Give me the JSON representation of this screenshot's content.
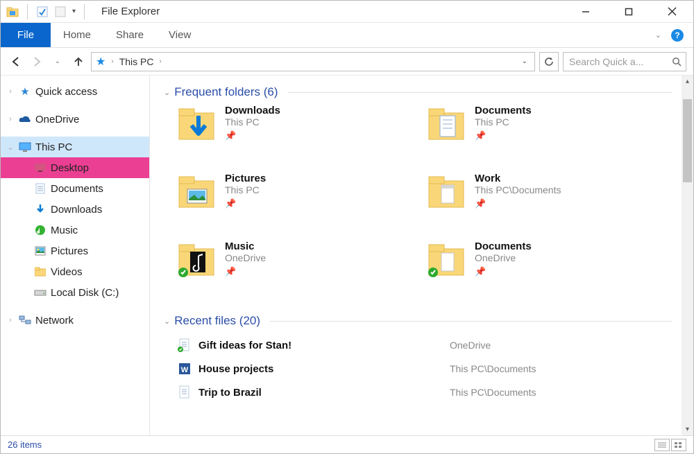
{
  "title": "File Explorer",
  "ribbon": {
    "file": "File",
    "home": "Home",
    "share": "Share",
    "view": "View"
  },
  "breadcrumb": [
    "This PC"
  ],
  "search_placeholder": "Search Quick a...",
  "sidebar": {
    "quick_access": "Quick access",
    "onedrive": "OneDrive",
    "this_pc": "This PC",
    "desktop": "Desktop",
    "documents": "Documents",
    "downloads": "Downloads",
    "music": "Music",
    "pictures": "Pictures",
    "videos": "Videos",
    "local_disk": "Local Disk (C:)",
    "network": "Network"
  },
  "groups": {
    "frequent": {
      "label": "Frequent folders",
      "count": 6
    },
    "recent": {
      "label": "Recent files",
      "count": 20
    }
  },
  "frequent_folders": [
    {
      "name": "Downloads",
      "path": "This PC",
      "icon": "downloads"
    },
    {
      "name": "Documents",
      "path": "This PC",
      "icon": "documents"
    },
    {
      "name": "Pictures",
      "path": "This PC",
      "icon": "pictures"
    },
    {
      "name": "Work",
      "path": "This PC\\Documents",
      "icon": "work"
    },
    {
      "name": "Music",
      "path": "OneDrive",
      "icon": "music-od"
    },
    {
      "name": "Documents",
      "path": "OneDrive",
      "icon": "documents-od"
    }
  ],
  "recent_files": [
    {
      "name": "Gift ideas for Stan!",
      "path": "OneDrive",
      "icon": "txt-sync"
    },
    {
      "name": "House projects",
      "path": "This PC\\Documents",
      "icon": "word"
    },
    {
      "name": "Trip to Brazil",
      "path": "This PC\\Documents",
      "icon": "txt"
    }
  ],
  "status": "26 items"
}
